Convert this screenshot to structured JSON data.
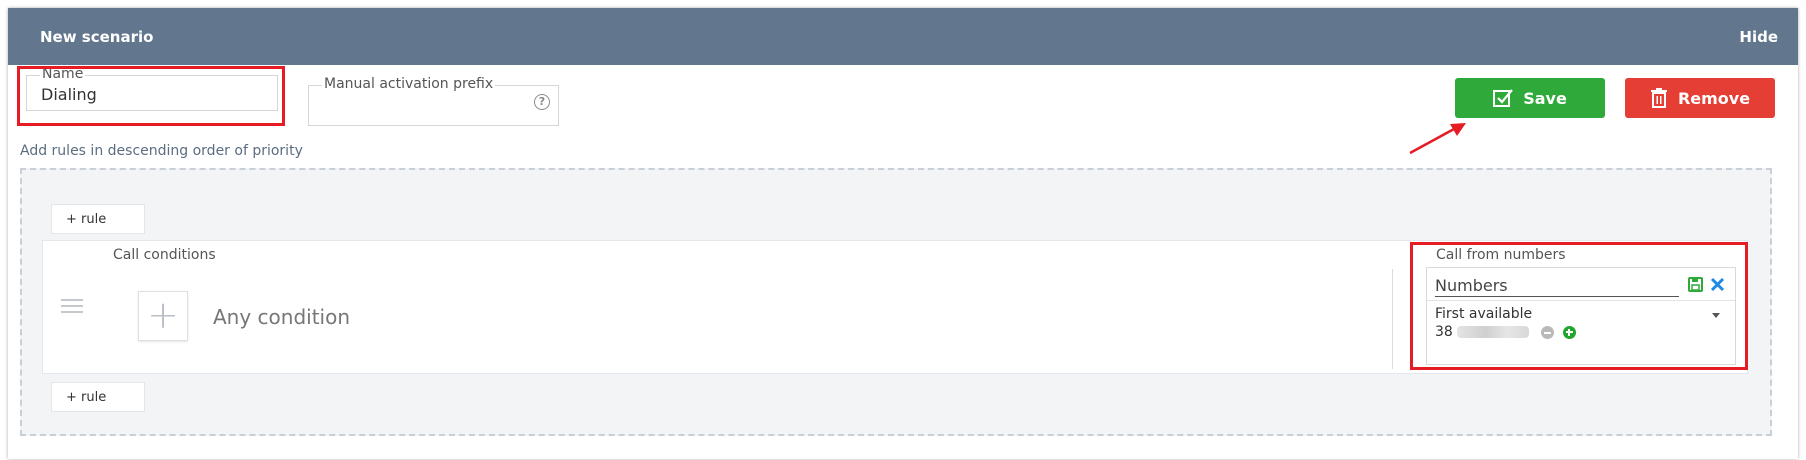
{
  "header": {
    "title": "New scenario",
    "hide_label": "Hide"
  },
  "form": {
    "name_label": "Name",
    "name_value": "Dialing",
    "prefix_label": "Manual activation prefix",
    "prefix_value": "",
    "help_glyph": "?"
  },
  "actions": {
    "save_label": "Save",
    "remove_label": "Remove"
  },
  "rules": {
    "instruction": "Add rules in descending order of priority",
    "add_rule_label": "+ rule",
    "call_conditions_label": "Call conditions",
    "add_condition_glyph": "+",
    "any_condition_label": "Any condition",
    "call_from_numbers_label": "Call from numbers",
    "numbers_placeholder": "Numbers",
    "strategy": "First available",
    "number_prefix": "38"
  },
  "colors": {
    "header_bg": "#62778d",
    "save": "#2faa3a",
    "remove": "#e53e35",
    "highlight": "#e51c23"
  },
  "icons": [
    "help-icon",
    "save-check-icon",
    "trash-icon",
    "drag-handle-icon",
    "add-condition-icon",
    "floppy-save-icon",
    "close-icon",
    "caret-down-icon",
    "remove-number-icon",
    "add-number-icon",
    "red-arrow-annotation"
  ]
}
